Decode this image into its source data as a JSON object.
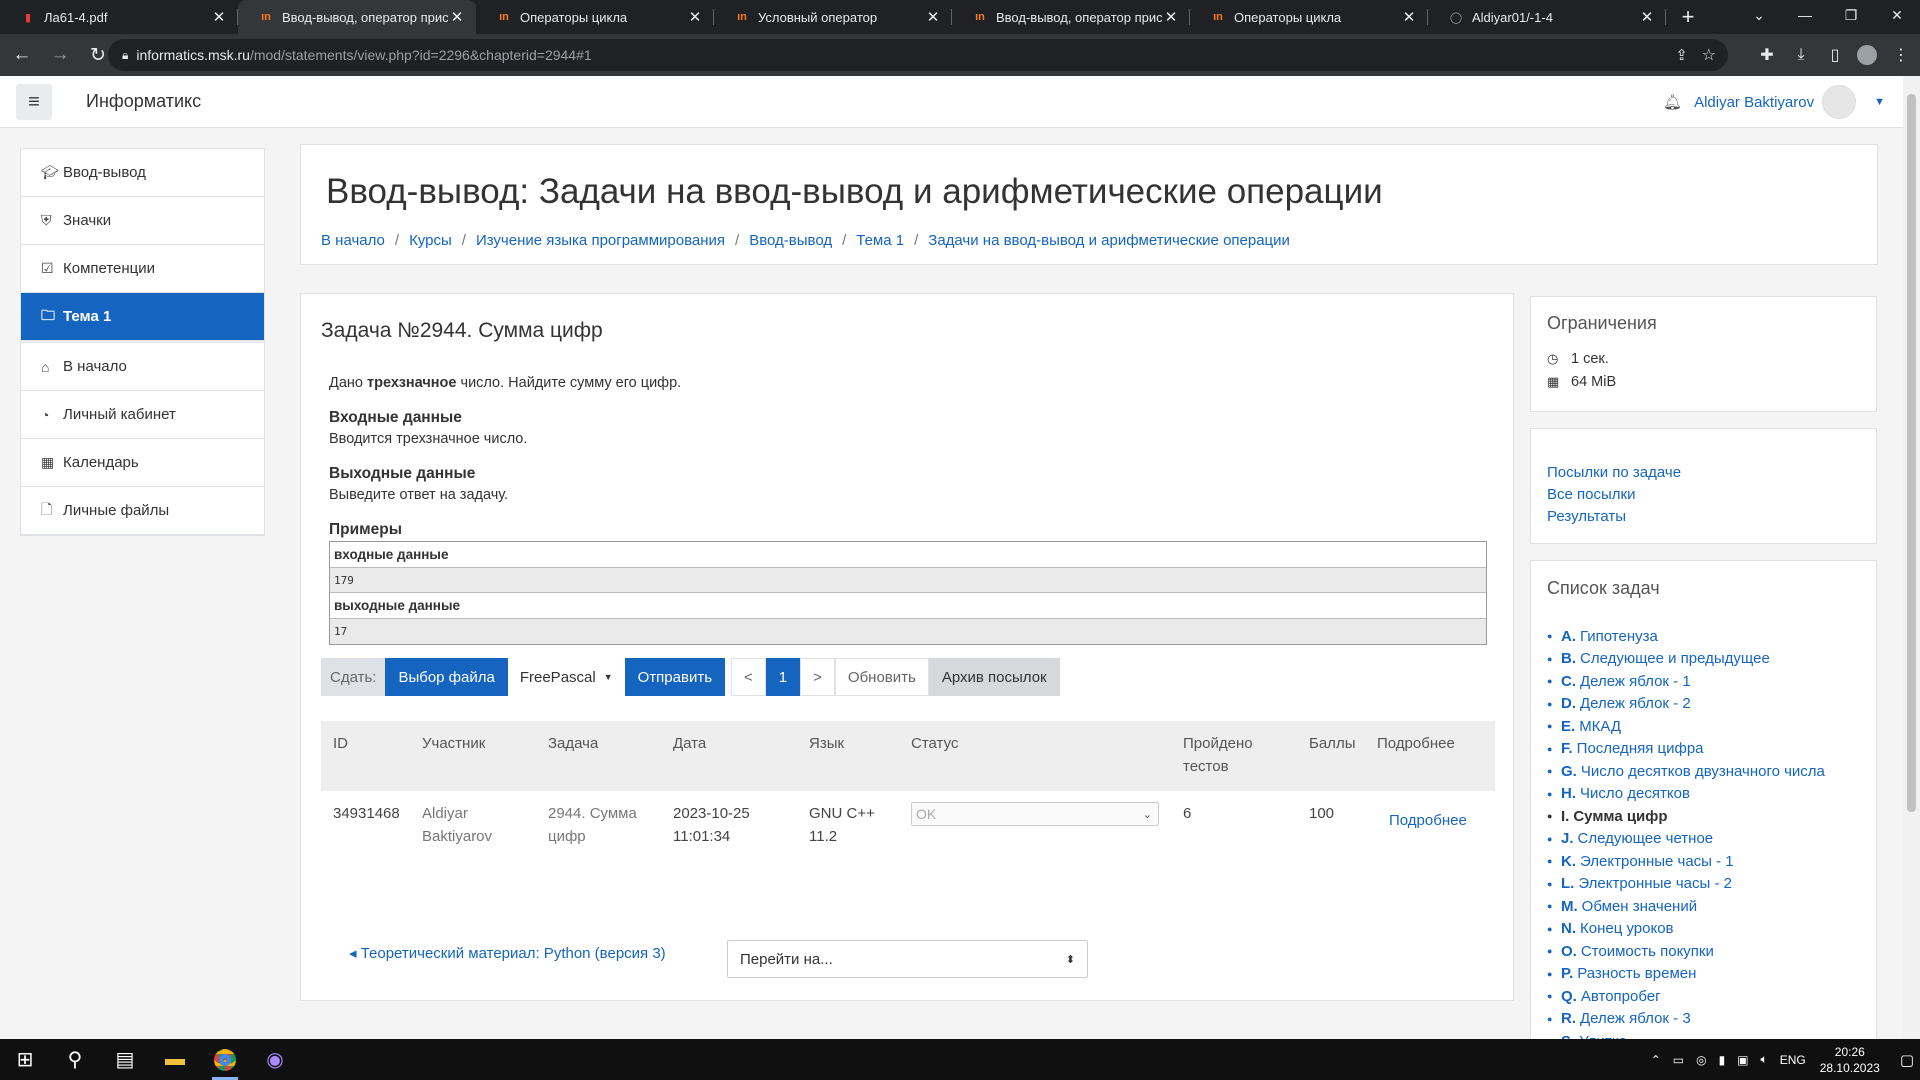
{
  "browser": {
    "tabs": [
      {
        "title": "Ла61-4.pdf",
        "icon": "pdf-icon",
        "active": false
      },
      {
        "title": "Ввод-вывод, оператор присва",
        "icon": "informatics-icon",
        "active": true
      },
      {
        "title": "Операторы цикла",
        "icon": "informatics-icon",
        "active": false
      },
      {
        "title": "Условный оператор",
        "icon": "informatics-icon",
        "active": false
      },
      {
        "title": "Ввод-вывод, оператор присва",
        "icon": "informatics-icon",
        "active": false
      },
      {
        "title": "Операторы цикла",
        "icon": "informatics-icon",
        "active": false
      },
      {
        "title": "Aldiyar01/-1-4",
        "icon": "github-icon",
        "active": false
      }
    ],
    "url_host": "informatics.msk.ru",
    "url_path": "/mod/statements/view.php?id=2296&chapterid=2944#1"
  },
  "site": {
    "brand": "Информатикс",
    "user_name": "Aldiyar Baktiyarov"
  },
  "leftnav": [
    {
      "label": "Ввод-вывод",
      "icon": "graduation-cap-icon"
    },
    {
      "label": "Значки",
      "icon": "shield-icon"
    },
    {
      "label": "Компетенции",
      "icon": "checkbox-icon"
    },
    {
      "label": "Тема 1",
      "icon": "folder-icon",
      "selected": true
    },
    {
      "label": "В начало",
      "icon": "home-icon"
    },
    {
      "label": "Личный кабинет",
      "icon": "dashboard-icon"
    },
    {
      "label": "Календарь",
      "icon": "calendar-icon"
    },
    {
      "label": "Личные файлы",
      "icon": "file-icon"
    }
  ],
  "header": {
    "title": "Ввод-вывод: Задачи на ввод-вывод и арифметические операции",
    "breadcrumbs": [
      "В начало",
      "Курсы",
      "Изучение языка программирования",
      "Ввод-вывод",
      "Тема 1",
      "Задачи на ввод-вывод и арифметические операции"
    ]
  },
  "problem": {
    "title": "Задача №2944. Сумма цифр",
    "statement_prefix": "Дано ",
    "statement_bold": "трехзначное",
    "statement_suffix": " число. Найдите сумму его цифр.",
    "input_heading": "Входные данные",
    "input_text": "Вводится трехзначное число.",
    "output_heading": "Выходные данные",
    "output_text": "Выведите ответ на задачу.",
    "examples_heading": "Примеры",
    "sample_input_label": "входные данные",
    "sample_input": "179",
    "sample_output_label": "выходные данные",
    "sample_output": "17"
  },
  "submit": {
    "label": "Сдать:",
    "choose_file": "Выбор файла",
    "language": "FreePascal",
    "send": "Отправить",
    "prev": "<",
    "page": "1",
    "next": ">",
    "refresh": "Обновить",
    "archive": "Архив посылок"
  },
  "submissions": {
    "headers": [
      "ID",
      "Участник",
      "Задача",
      "Дата",
      "Язык",
      "Статус",
      "Пройдено тестов",
      "Баллы",
      "Подробнее"
    ],
    "rows": [
      {
        "id": "34931468",
        "user": "Aldiyar Baktiyarov",
        "task": "2944. Сумма цифр",
        "date": "2023-10-25 11:01:34",
        "lang": "GNU C++ 11.2",
        "status": "OK",
        "passed": "6",
        "score": "100",
        "details": "Подробнее"
      }
    ]
  },
  "bottom": {
    "prev_link": "Теоретический материал: Python (версия 3)",
    "jump_placeholder": "Перейти на..."
  },
  "sidebar": {
    "limits_title": "Ограничения",
    "time_limit": "1 сек.",
    "memory_limit": "64 MiB",
    "links": [
      "Посылки по задаче",
      "Все посылки",
      "Результаты"
    ],
    "tasks_title": "Список задач",
    "tasks": [
      {
        "letter": "A.",
        "name": "Гипотенуза"
      },
      {
        "letter": "B.",
        "name": "Следующее и предыдущее"
      },
      {
        "letter": "C.",
        "name": "Дележ яблок - 1"
      },
      {
        "letter": "D.",
        "name": "Дележ яблок - 2"
      },
      {
        "letter": "E.",
        "name": "МКАД"
      },
      {
        "letter": "F.",
        "name": "Последняя цифра"
      },
      {
        "letter": "G.",
        "name": "Число десятков двузначного числа"
      },
      {
        "letter": "H.",
        "name": "Число десятков"
      },
      {
        "letter": "I.",
        "name": "Сумма цифр",
        "current": true
      },
      {
        "letter": "J.",
        "name": "Следующее четное"
      },
      {
        "letter": "K.",
        "name": "Электронные часы - 1"
      },
      {
        "letter": "L.",
        "name": "Электронные часы - 2"
      },
      {
        "letter": "M.",
        "name": "Обмен значений"
      },
      {
        "letter": "N.",
        "name": "Конец уроков"
      },
      {
        "letter": "O.",
        "name": "Стоимость покупки"
      },
      {
        "letter": "P.",
        "name": "Разность времен"
      },
      {
        "letter": "Q.",
        "name": "Автопробег"
      },
      {
        "letter": "R.",
        "name": "Дележ яблок - 3"
      },
      {
        "letter": "S.",
        "name": "Улитка"
      }
    ]
  },
  "taskbar": {
    "lang": "ENG",
    "time": "20:26",
    "date": "28.10.2023"
  },
  "colors": {
    "accent": "#1565c0",
    "chrome_dark": "#202124",
    "chrome_mid": "#35363a"
  }
}
